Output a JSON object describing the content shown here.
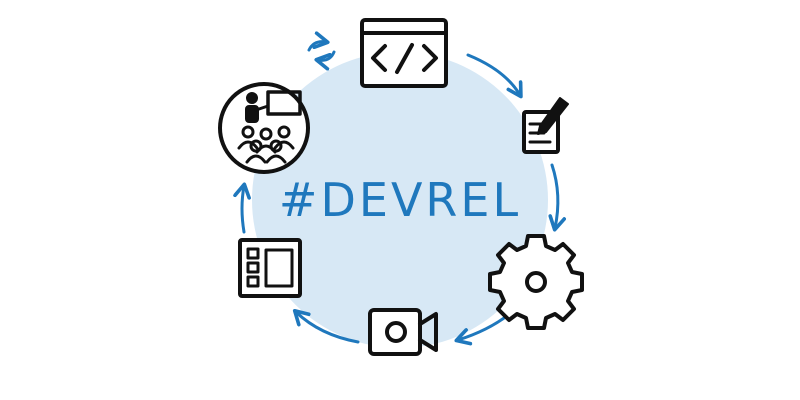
{
  "center": {
    "title": "#DEVREL"
  },
  "icons": [
    "code-icon",
    "writing-icon",
    "gear-icon",
    "video-camera-icon",
    "layout-icon",
    "presentation-icon",
    "refresh-icon"
  ],
  "colors": {
    "circle": "#d7e8f5",
    "accent": "#1f78bd",
    "ink": "#111111"
  }
}
